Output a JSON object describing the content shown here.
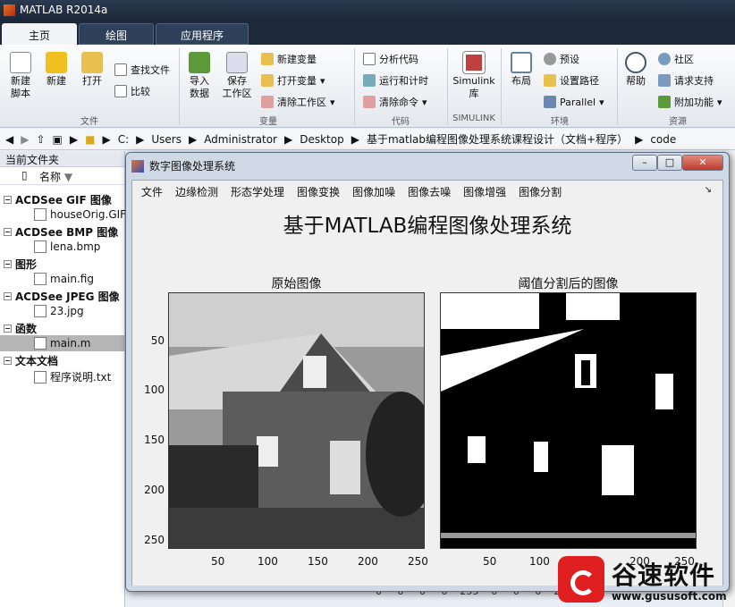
{
  "window": {
    "title": "MATLAB R2014a"
  },
  "tabs": [
    "主页",
    "绘图",
    "应用程序"
  ],
  "ribbon": {
    "file": {
      "new_script": "新建\n脚本",
      "new": "新建",
      "open": "打开",
      "find_files": "查找文件",
      "compare": "比较",
      "group": "文件"
    },
    "variable": {
      "import": "导入\n数据",
      "save_ws": "保存\n工作区",
      "new_var": "新建变量",
      "open_var": "打开变量",
      "clear_ws": "清除工作区",
      "group": "变量"
    },
    "code": {
      "analyze": "分析代码",
      "run_time": "运行和计时",
      "clear_cmd": "清除命令",
      "group": "代码"
    },
    "simulink": {
      "lib": "Simulink\n库",
      "group": "SIMULINK"
    },
    "env": {
      "layout": "布局",
      "prefs": "预设",
      "set_path": "设置路径",
      "parallel": "Parallel",
      "group": "环境"
    },
    "resources": {
      "help": "帮助",
      "community": "社区",
      "support": "请求支持",
      "addons": "附加功能",
      "group": "资源"
    }
  },
  "address": [
    "C:",
    "Users",
    "Administrator",
    "Desktop",
    "基于matlab编程图像处理系统课程设计（文档+程序）",
    "code"
  ],
  "left_panel": {
    "title": "当前文件夹",
    "col_name": "名称",
    "categories": [
      {
        "label": "ACDSee GIF 图像",
        "file": "houseOrig.GIF"
      },
      {
        "label": "ACDSee BMP 图像",
        "file": "lena.bmp"
      },
      {
        "label": "图形",
        "file": "main.fig"
      },
      {
        "label": "ACDSee JPEG 图像",
        "file": "23.jpg"
      },
      {
        "label": "函数",
        "file": "main.m"
      },
      {
        "label": "文本文档",
        "file": "程序说明.txt"
      }
    ]
  },
  "figure": {
    "title": "数字图像处理系统",
    "menu": [
      "文件",
      "边缘检测",
      "形态学处理",
      "图像变换",
      "图像加噪",
      "图像去噪",
      "图像增强",
      "图像分割"
    ],
    "main_title": "基于MATLAB编程图像处理系统",
    "axes_left_title": "原始图像",
    "axes_right_title": "阈值分割后的图像",
    "yticks": [
      "50",
      "100",
      "150",
      "200",
      "250"
    ],
    "xticks": [
      "50",
      "100",
      "150",
      "200",
      "250"
    ]
  },
  "bottom_values": "0     0     0     0    255    0     0     0    255",
  "watermark": {
    "name": "谷速软件",
    "url": "www.gususoft.com"
  }
}
